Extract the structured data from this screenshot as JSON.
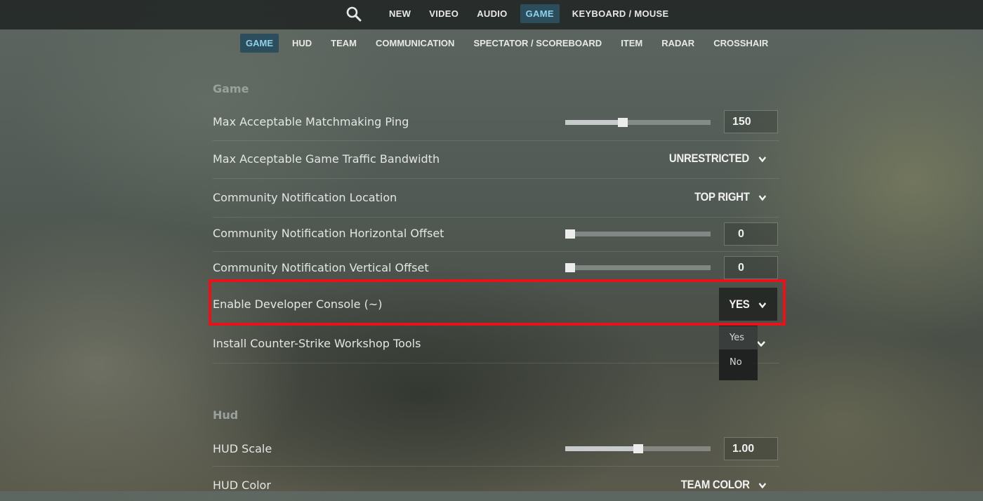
{
  "top_nav": {
    "search_icon": "search-icon",
    "tabs": [
      {
        "label": "NEW"
      },
      {
        "label": "VIDEO"
      },
      {
        "label": "AUDIO"
      },
      {
        "label": "GAME",
        "active": true
      },
      {
        "label": "KEYBOARD / MOUSE"
      }
    ]
  },
  "sub_nav": {
    "tabs": [
      {
        "label": "GAME",
        "active": true
      },
      {
        "label": "HUD"
      },
      {
        "label": "TEAM"
      },
      {
        "label": "COMMUNICATION"
      },
      {
        "label": "SPECTATOR / SCOREBOARD"
      },
      {
        "label": "ITEM"
      },
      {
        "label": "RADAR"
      },
      {
        "label": "CROSSHAIR"
      }
    ]
  },
  "sections": {
    "game": {
      "title": "Game",
      "rows": {
        "ping": {
          "label": "Max Acceptable Matchmaking Ping",
          "value": "150",
          "slider_fraction": 0.39
        },
        "bandwidth": {
          "label": "Max Acceptable Game Traffic Bandwidth",
          "value": "UNRESTRICTED"
        },
        "notif_location": {
          "label": "Community Notification Location",
          "value": "TOP RIGHT"
        },
        "notif_h_offset": {
          "label": "Community Notification Horizontal Offset",
          "value": "0",
          "slider_fraction": 0.0
        },
        "notif_v_offset": {
          "label": "Community Notification Vertical Offset",
          "value": "0",
          "slider_fraction": 0.0
        },
        "dev_console": {
          "label": "Enable Developer Console (~)",
          "value": "YES",
          "options": [
            "Yes",
            "No"
          ]
        },
        "workshop_tools": {
          "label": "Install Counter-Strike Workshop Tools"
        }
      }
    },
    "hud": {
      "title": "Hud",
      "rows": {
        "hud_scale": {
          "label": "HUD Scale",
          "value": "1.00",
          "slider_fraction": 0.5
        },
        "hud_color": {
          "label": "HUD Color",
          "value": "TEAM COLOR"
        }
      }
    }
  },
  "colors": {
    "active_tab_bg": "#2c4d5c",
    "active_tab_text": "#8fd1ec",
    "highlight_border": "#e8131a"
  }
}
